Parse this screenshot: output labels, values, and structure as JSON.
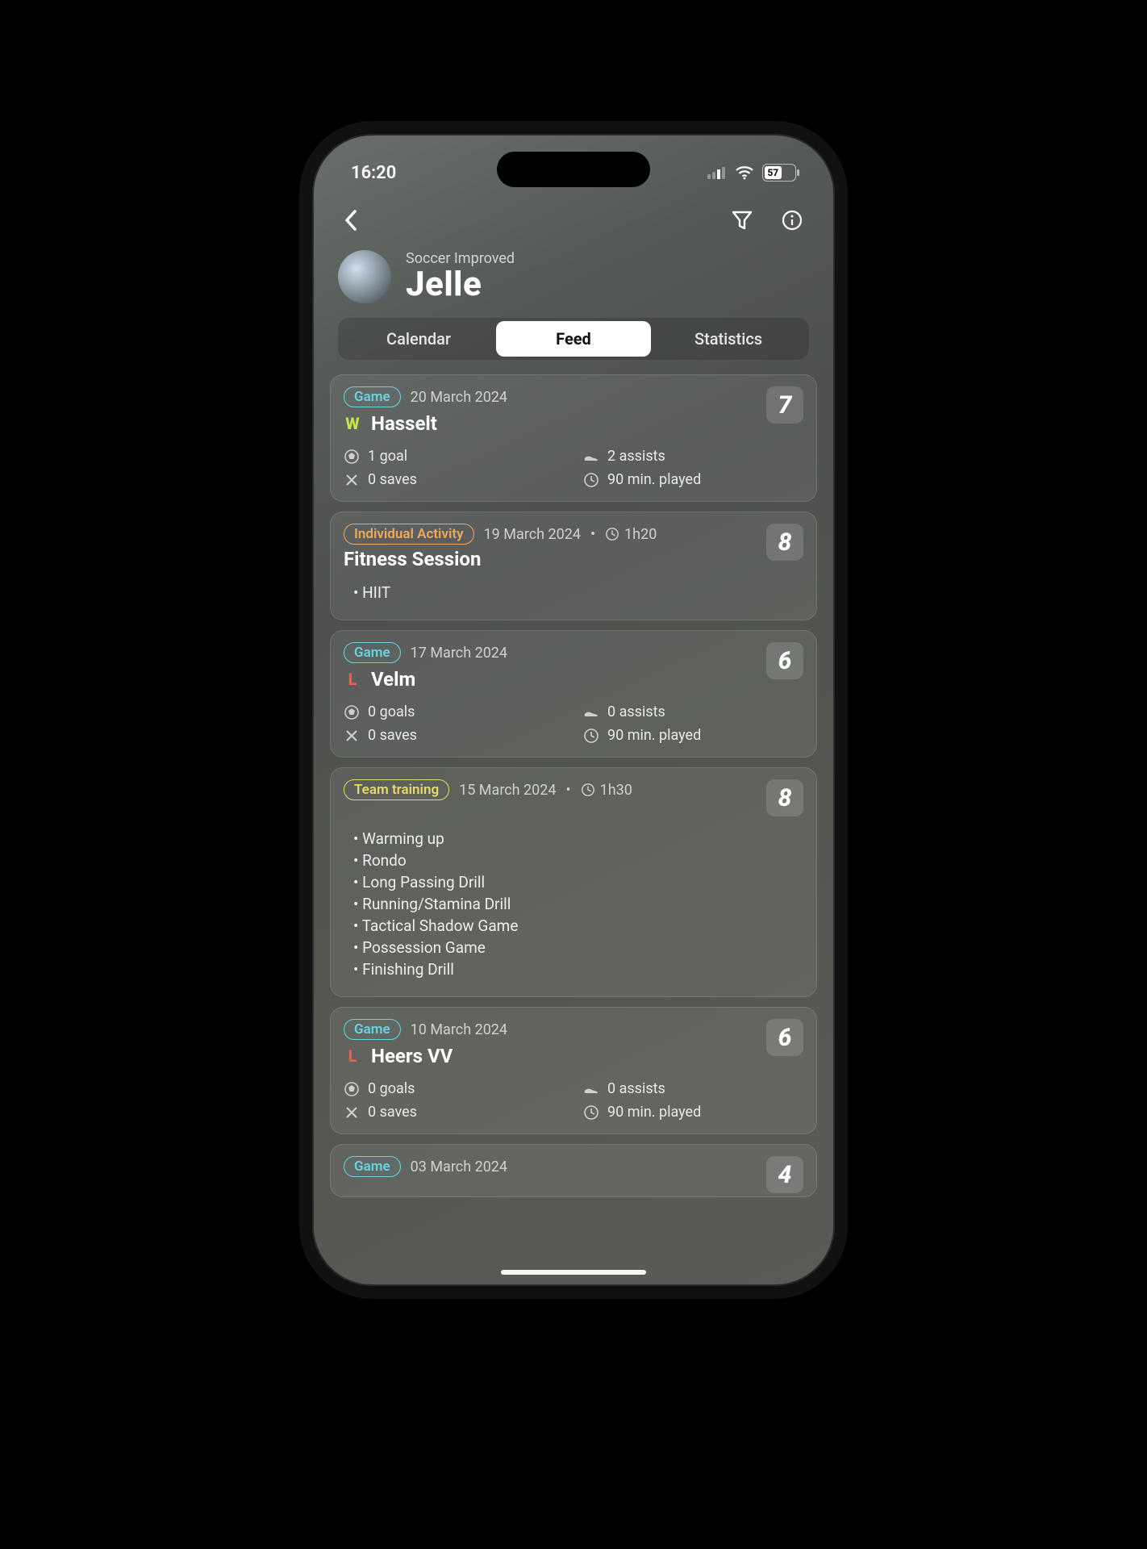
{
  "status": {
    "time": "16:20",
    "battery": "57"
  },
  "header": {
    "subtitle": "Soccer Improved",
    "title": "Jelle"
  },
  "tabs": {
    "calendar": "Calendar",
    "feed": "Feed",
    "statistics": "Statistics",
    "active": "feed"
  },
  "labels": {
    "game": "Game",
    "individual": "Individual Activity",
    "team": "Team training"
  },
  "cards": [
    {
      "type": "game",
      "date": "20 March 2024",
      "result": "W",
      "opponent": "Hasselt",
      "score": "7",
      "stats": {
        "goals": "1 goal",
        "assists": "2 assists",
        "saves": "0 saves",
        "played": "90 min. played"
      }
    },
    {
      "type": "individual",
      "date": "19 March 2024",
      "duration": "1h20",
      "title": "Fitness Session",
      "score": "8",
      "bullets": [
        "HIIT"
      ]
    },
    {
      "type": "game",
      "date": "17 March 2024",
      "result": "L",
      "opponent": "Velm",
      "score": "6",
      "stats": {
        "goals": "0 goals",
        "assists": "0 assists",
        "saves": "0 saves",
        "played": "90 min. played"
      }
    },
    {
      "type": "team",
      "date": "15 March 2024",
      "duration": "1h30",
      "score": "8",
      "bullets": [
        "Warming up",
        "Rondo",
        "Long Passing Drill",
        "Running/Stamina Drill",
        "Tactical Shadow Game",
        "Possession Game",
        "Finishing Drill"
      ]
    },
    {
      "type": "game",
      "date": "10 March 2024",
      "result": "L",
      "opponent": "Heers VV",
      "score": "6",
      "stats": {
        "goals": "0 goals",
        "assists": "0 assists",
        "saves": "0 saves",
        "played": "90 min. played"
      }
    },
    {
      "type": "game",
      "date": "03 March 2024",
      "score": "4"
    }
  ]
}
